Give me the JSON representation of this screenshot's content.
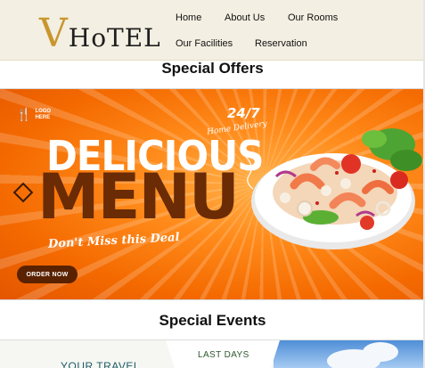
{
  "brand": {
    "initial": "V",
    "name": "HoTEL",
    "accent_color": "#c9962e"
  },
  "nav": {
    "items": [
      "Home",
      "About Us",
      "Our Rooms",
      "Our Facilities",
      "Reservation"
    ]
  },
  "sections": {
    "offers_title": "Special Offers",
    "events_title": "Special Events"
  },
  "offer_banner": {
    "logo_icon": "fork-knife-icon",
    "logo_text": "LOGO HERE",
    "headline": "DELICIOUS",
    "subheadline": "MENU",
    "tagline": "Don't Miss this Deal",
    "delivery_hours": "24/7",
    "delivery_label": "Home Delivery",
    "cta_label": "ORDER NOW",
    "background_color": "#f46a00",
    "accent_color": "#6a2b05"
  },
  "event_banner": {
    "badge": "LAST DAYS",
    "headline": "YOUR TRAVEL"
  }
}
